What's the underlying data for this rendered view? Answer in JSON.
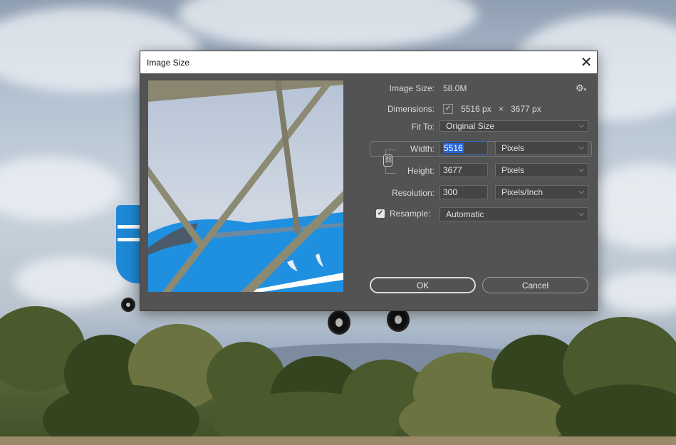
{
  "dialog": {
    "title": "Image Size",
    "close_label": "✕",
    "image_size_label": "Image Size:",
    "image_size_value": "58.0M",
    "dimensions_label": "Dimensions:",
    "dimensions_width": "5516 px",
    "dimensions_times": "×",
    "dimensions_height": "3677 px",
    "fit_to_label": "Fit To:",
    "fit_to_value": "Original Size",
    "width_label": "Width:",
    "width_value": "5516",
    "width_unit": "Pixels",
    "height_label": "Height:",
    "height_value": "3677",
    "height_unit": "Pixels",
    "resolution_label": "Resolution:",
    "resolution_value": "300",
    "resolution_unit": "Pixels/Inch",
    "resample_label": "Resample:",
    "resample_checked": true,
    "resample_value": "Automatic",
    "ok_label": "OK",
    "cancel_label": "Cancel"
  },
  "icons": {
    "settings": "gear-icon",
    "chevron": "chevron-down-icon",
    "link": "chain-link-icon",
    "check": "checkmark-icon"
  },
  "colors": {
    "dialog_bg": "#535353",
    "field_bg": "#454545",
    "focus": "#2f6fd1",
    "selection": "#2465d8"
  }
}
